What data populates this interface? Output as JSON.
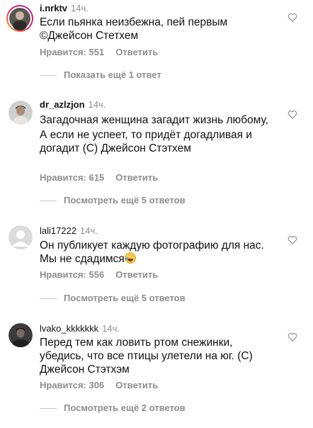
{
  "comments": [
    {
      "username": "i.nrktv",
      "time": "14ч.",
      "lines": [
        "Если пьянка неизбежна, пей первым",
        "©Джейсон Стетхем"
      ],
      "likes": "Нравится: 551",
      "reply": "Ответить",
      "more": "Показать ещё 1 ответ"
    },
    {
      "username": "dr_azlzjon",
      "time": "14ч.",
      "lines": [
        "Загадочная женщина загадит жизнь любому,",
        "А если не успеет, то придёт догадливая и догадит (С) Джейсон Стэтхем"
      ],
      "likes": "Нравится: 615",
      "reply": "Ответить",
      "more": "Посмотреть ещё 5 ответов"
    },
    {
      "username": "lali17222",
      "time": "14ч.",
      "lines": [
        "Он публикует каждую фотографию для нас. Мы не сдадимся"
      ],
      "likes": "Нравится: 556",
      "reply": "Ответить",
      "more": "Посмотреть ещё 5 ответов"
    },
    {
      "username": "lvako_kkkkkkk",
      "time": "14ч.",
      "lines": [
        "Перед тем как ловить ртом снежинки, убедись, что все птицы улетели на юг. (С) Джейсон Стэтхэм"
      ],
      "likes": "Нравится: 306",
      "reply": "Ответить",
      "more": "Посмотреть ещё 2 ответов"
    }
  ],
  "icons": {
    "heart": "heart-outline-icon",
    "emoji": "laughing-tears-emoji"
  },
  "colors": {
    "muted": "#8e8e8e",
    "text": "#111111",
    "story_ring_start": "#f9a825",
    "story_ring_end": "#c2185b"
  }
}
